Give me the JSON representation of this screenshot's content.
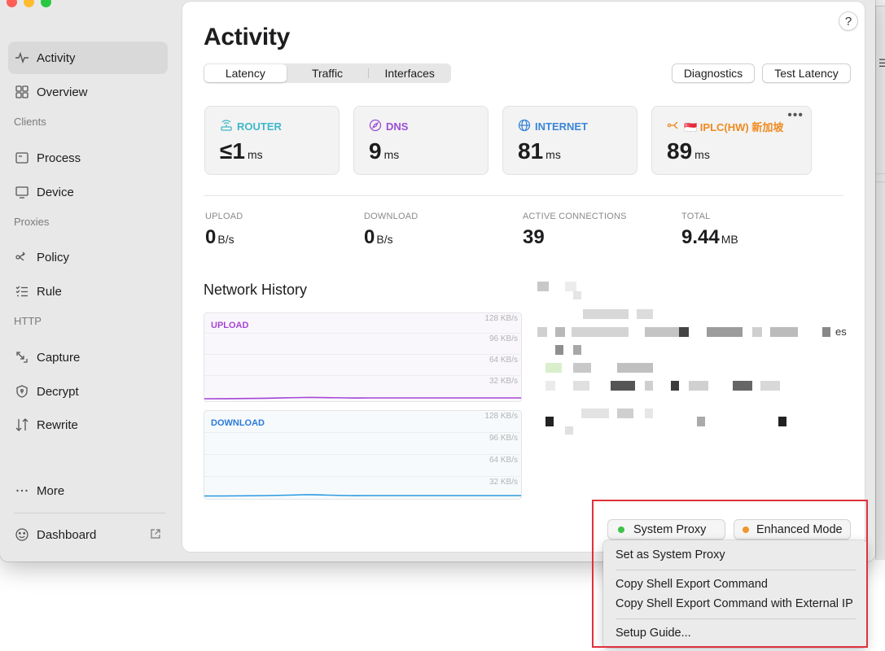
{
  "sidebar": {
    "items": [
      {
        "label": "Activity",
        "icon": "activity-icon",
        "active": true
      },
      {
        "label": "Overview",
        "icon": "grid-icon"
      },
      {
        "label": "Process",
        "icon": "process-icon"
      },
      {
        "label": "Device",
        "icon": "monitor-icon"
      },
      {
        "label": "Policy",
        "icon": "policy-icon"
      },
      {
        "label": "Rule",
        "icon": "list-icon"
      },
      {
        "label": "Capture",
        "icon": "capture-icon"
      },
      {
        "label": "Decrypt",
        "icon": "shield-icon"
      },
      {
        "label": "Rewrite",
        "icon": "rewrite-icon"
      },
      {
        "label": "More",
        "icon": "ellipsis-icon"
      },
      {
        "label": "Dashboard",
        "icon": "dashboard-icon"
      }
    ],
    "sections": {
      "clients": "Clients",
      "proxies": "Proxies",
      "http": "HTTP"
    }
  },
  "header": {
    "title": "Activity",
    "help": "?",
    "tabs": [
      {
        "label": "Latency",
        "active": true
      },
      {
        "label": "Traffic"
      },
      {
        "label": "Interfaces"
      }
    ],
    "buttons": {
      "diagnostics": "Diagnostics",
      "test_latency": "Test Latency"
    }
  },
  "latency_cards": [
    {
      "label": "ROUTER",
      "value": "≤1",
      "unit": "ms",
      "color": "#3fb7c9",
      "icon": "router-icon"
    },
    {
      "label": "DNS",
      "value": "9",
      "unit": "ms",
      "color": "#9b4fd6",
      "icon": "compass-icon"
    },
    {
      "label": "INTERNET",
      "value": "81",
      "unit": "ms",
      "color": "#3b86d8",
      "icon": "globe-icon"
    },
    {
      "label": "🇸🇬 IPLC(HW) 新加坡",
      "value": "89",
      "unit": "ms",
      "color": "#ef8a1f",
      "icon": "share-icon",
      "more": "•••"
    }
  ],
  "stats": [
    {
      "caption": "UPLOAD",
      "value": "0",
      "unit": "B/s"
    },
    {
      "caption": "DOWNLOAD",
      "value": "0",
      "unit": "B/s"
    },
    {
      "caption": "ACTIVE CONNECTIONS",
      "value": "39",
      "unit": ""
    },
    {
      "caption": "TOTAL",
      "value": "9.44",
      "unit": "MB"
    }
  ],
  "network_history": {
    "title": "Network History",
    "upload": {
      "label": "UPLOAD",
      "color": "#a445d6",
      "ticks": [
        "128 KB/s",
        "96 KB/s",
        "64 KB/s",
        "32 KB/s"
      ]
    },
    "download": {
      "label": "DOWNLOAD",
      "color": "#2b7bd6",
      "ticks": [
        "128 KB/s",
        "96 KB/s",
        "64 KB/s",
        "32 KB/s"
      ]
    }
  },
  "info_fragment": "es",
  "footer": {
    "system_proxy": {
      "label": "System Proxy",
      "dot_color": "#3cc24a"
    },
    "enhanced_mode": {
      "label": "Enhanced Mode",
      "dot_color": "#f0962c"
    }
  },
  "menu": {
    "items": [
      "Set as System Proxy",
      "Copy Shell Export Command",
      "Copy Shell Export Command with External IP",
      "Setup Guide..."
    ]
  }
}
